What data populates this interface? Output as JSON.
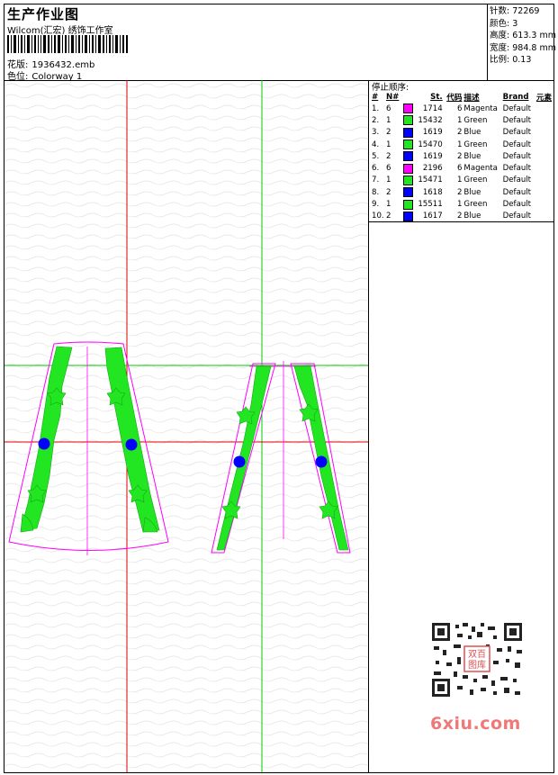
{
  "header": {
    "title": "生产作业图",
    "company": "Wilcom(汇宏) 绣饰工作室",
    "design_label": "花版:",
    "design_value": "1936432.emb",
    "colorway_label": "色位:",
    "colorway_value": "Colorway 1"
  },
  "stats": [
    {
      "label": "针数:",
      "value": "72269"
    },
    {
      "label": "颜色:",
      "value": "3"
    },
    {
      "label": "高度:",
      "value": "613.3 mm"
    },
    {
      "label": "宽度:",
      "value": "984.8 mm"
    },
    {
      "label": "比例:",
      "value": "0.13"
    }
  ],
  "stop_sequence": {
    "title": "停止顺序:",
    "columns": [
      "#",
      "N#",
      "St.",
      "代码",
      "描述",
      "Brand",
      "元素"
    ],
    "rows": [
      {
        "num": "1.",
        "n": "6",
        "color": "#ff00ff",
        "st": "1714",
        "code": "6",
        "desc": "Magenta",
        "brand": "Default"
      },
      {
        "num": "2.",
        "n": "1",
        "color": "#22e622",
        "st": "15432",
        "code": "1",
        "desc": "Green",
        "brand": "Default"
      },
      {
        "num": "3.",
        "n": "2",
        "color": "#0000ff",
        "st": "1619",
        "code": "2",
        "desc": "Blue",
        "brand": "Default"
      },
      {
        "num": "4.",
        "n": "1",
        "color": "#22e622",
        "st": "15470",
        "code": "1",
        "desc": "Green",
        "brand": "Default"
      },
      {
        "num": "5.",
        "n": "2",
        "color": "#0000ff",
        "st": "1619",
        "code": "2",
        "desc": "Blue",
        "brand": "Default"
      },
      {
        "num": "6.",
        "n": "6",
        "color": "#ff00ff",
        "st": "2196",
        "code": "6",
        "desc": "Magenta",
        "brand": "Default"
      },
      {
        "num": "7.",
        "n": "1",
        "color": "#22e622",
        "st": "15471",
        "code": "1",
        "desc": "Green",
        "brand": "Default"
      },
      {
        "num": "8.",
        "n": "2",
        "color": "#0000ff",
        "st": "1618",
        "code": "2",
        "desc": "Blue",
        "brand": "Default"
      },
      {
        "num": "9.",
        "n": "1",
        "color": "#22e622",
        "st": "15511",
        "code": "1",
        "desc": "Green",
        "brand": "Default"
      },
      {
        "num": "10.",
        "n": "2",
        "color": "#0000ff",
        "st": "1617",
        "code": "2",
        "desc": "Blue",
        "brand": "Default"
      }
    ]
  },
  "watermark": {
    "text": "6xiu.com",
    "seal_lines": [
      "双百",
      "图库"
    ]
  },
  "colors": {
    "magenta": "#ff00ff",
    "green": "#22e622",
    "blue": "#0000ff",
    "guide_red": "#e00000",
    "guide_green": "#00cc00",
    "watermark": "#f07878"
  }
}
